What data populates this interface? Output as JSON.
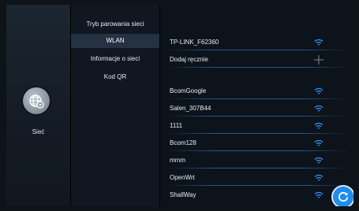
{
  "side_nav": {
    "label": "Sieć",
    "icon": "globe-settings-icon"
  },
  "menu": {
    "items": [
      {
        "label": "Tryb parowania sieci"
      },
      {
        "label": "WLAN",
        "active": true
      },
      {
        "label": "Informacje o sieci"
      },
      {
        "label": "Kod QR"
      }
    ]
  },
  "networks": {
    "connected": [
      {
        "ssid": "TP-LINK_F62360",
        "icon": "wifi-icon"
      }
    ],
    "add_manually": {
      "label": "Dodaj ręcznie",
      "icon": "plus-icon"
    },
    "available": [
      {
        "ssid": "BcomGoogle",
        "icon": "wifi-icon"
      },
      {
        "ssid": "Salen_307B44",
        "icon": "wifi-icon"
      },
      {
        "ssid": "1111",
        "icon": "wifi-icon"
      },
      {
        "ssid": "Bcom128",
        "icon": "wifi-icon"
      },
      {
        "ssid": "mmm",
        "icon": "wifi-icon"
      },
      {
        "ssid": "OpenWrt",
        "icon": "wifi-icon"
      },
      {
        "ssid": "ShallWay",
        "icon": "wifi-icon"
      }
    ]
  },
  "refresh": {
    "icon": "refresh-icon"
  },
  "colors": {
    "accent": "#1f8cf0",
    "menu_active": "#243243",
    "background": "#0b0f16"
  }
}
